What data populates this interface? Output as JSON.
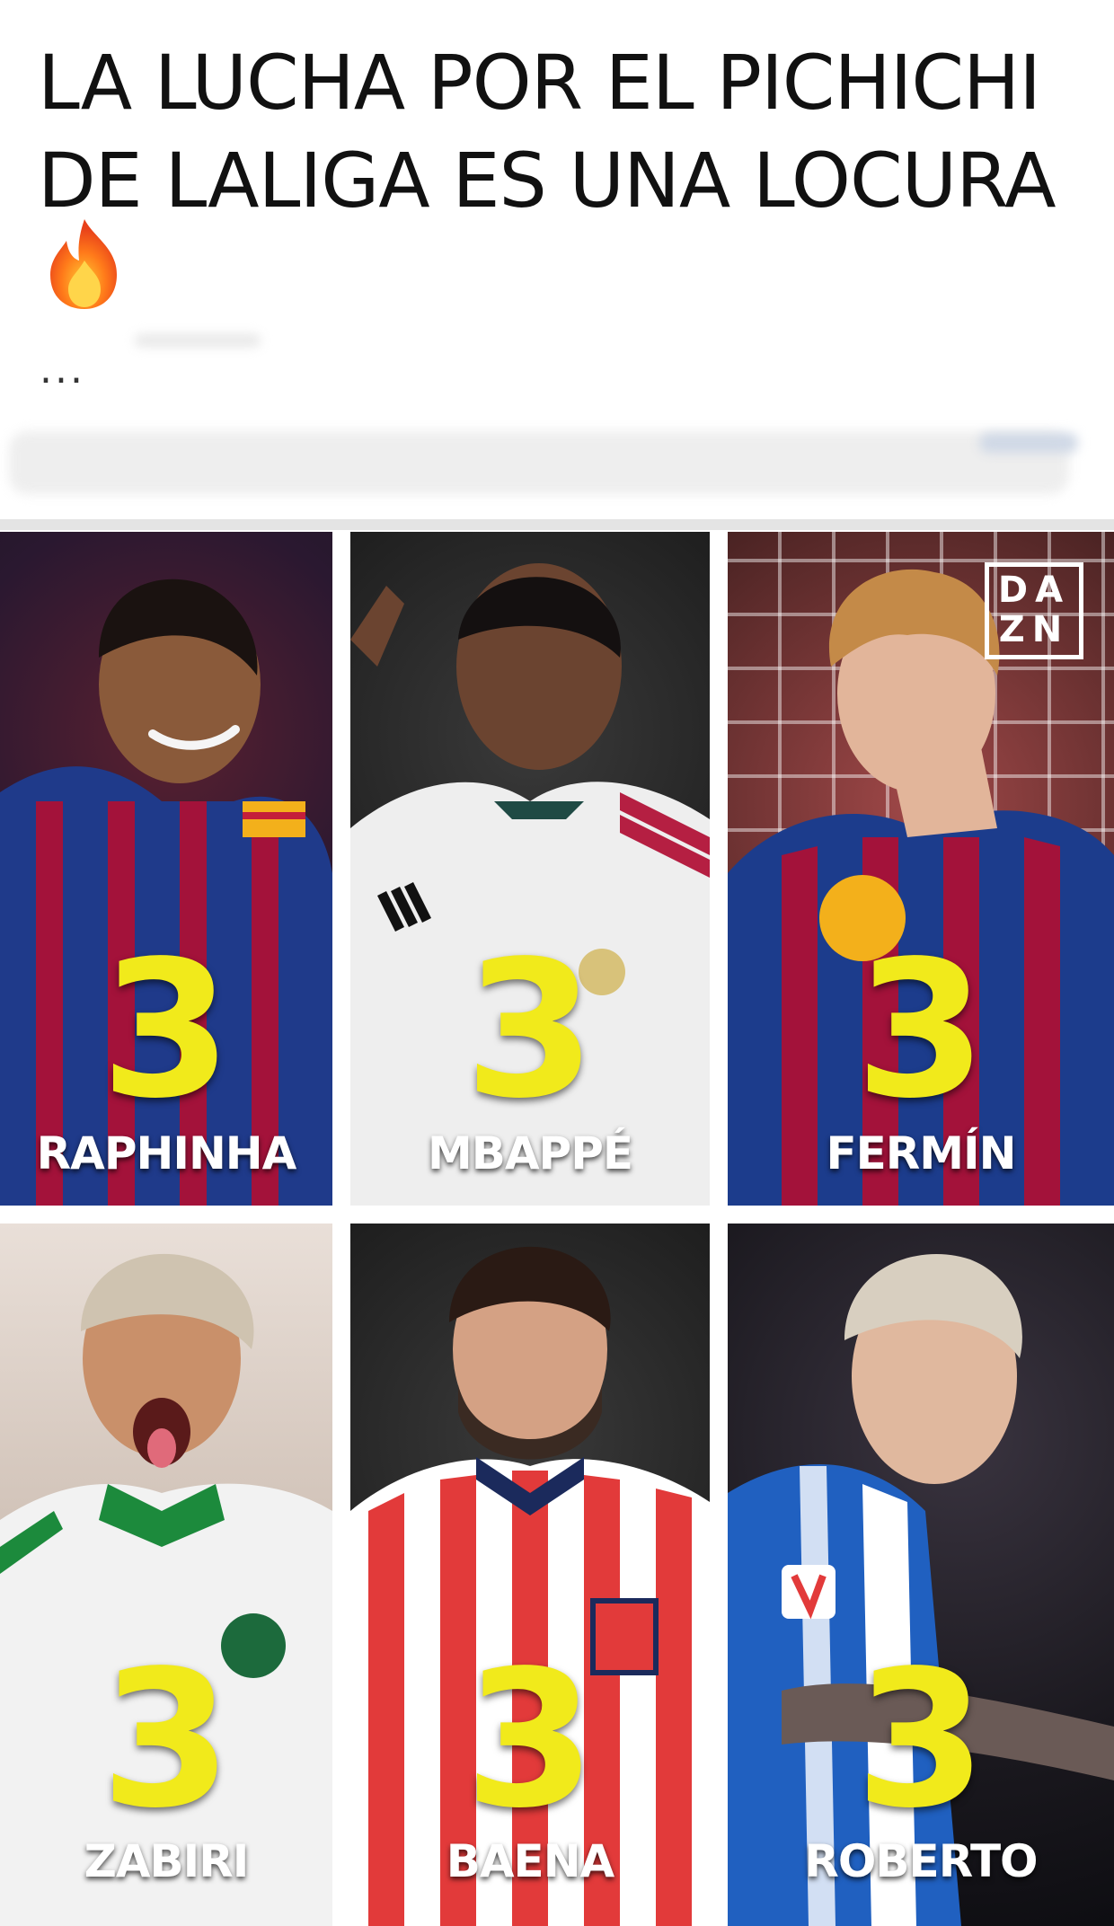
{
  "post": {
    "title": "LA LUCHA POR EL PICHICHI DE LALIGA ES UNA LOCURA",
    "ellipsis": "...",
    "fire_icon": "fire-emoji"
  },
  "watermark": {
    "line1": "DA",
    "line2": "ZN"
  },
  "players": [
    {
      "name": "RAPHINHA",
      "goals": "3",
      "kit_primary": "#1f3a8a",
      "kit_secondary": "#a3123a"
    },
    {
      "name": "MBAPPÉ",
      "goals": "3",
      "kit_primary": "#eeeeee",
      "kit_secondary": "#b51f42"
    },
    {
      "name": "FERMÍN",
      "goals": "3",
      "kit_primary": "#1c3c8c",
      "kit_secondary": "#a3123a"
    },
    {
      "name": "ZABIRI",
      "goals": "3",
      "kit_primary": "#f2f2f2",
      "kit_secondary": "#1c8a3c"
    },
    {
      "name": "BAENA",
      "goals": "3",
      "kit_primary": "#e23a3a",
      "kit_secondary": "#ffffff"
    },
    {
      "name": "ROBERTO",
      "goals": "3",
      "kit_primary": "#2060c0",
      "kit_secondary": "#ffffff"
    }
  ],
  "colors": {
    "goal_number": "#f1ea1b",
    "name_text": "#ffffff"
  }
}
